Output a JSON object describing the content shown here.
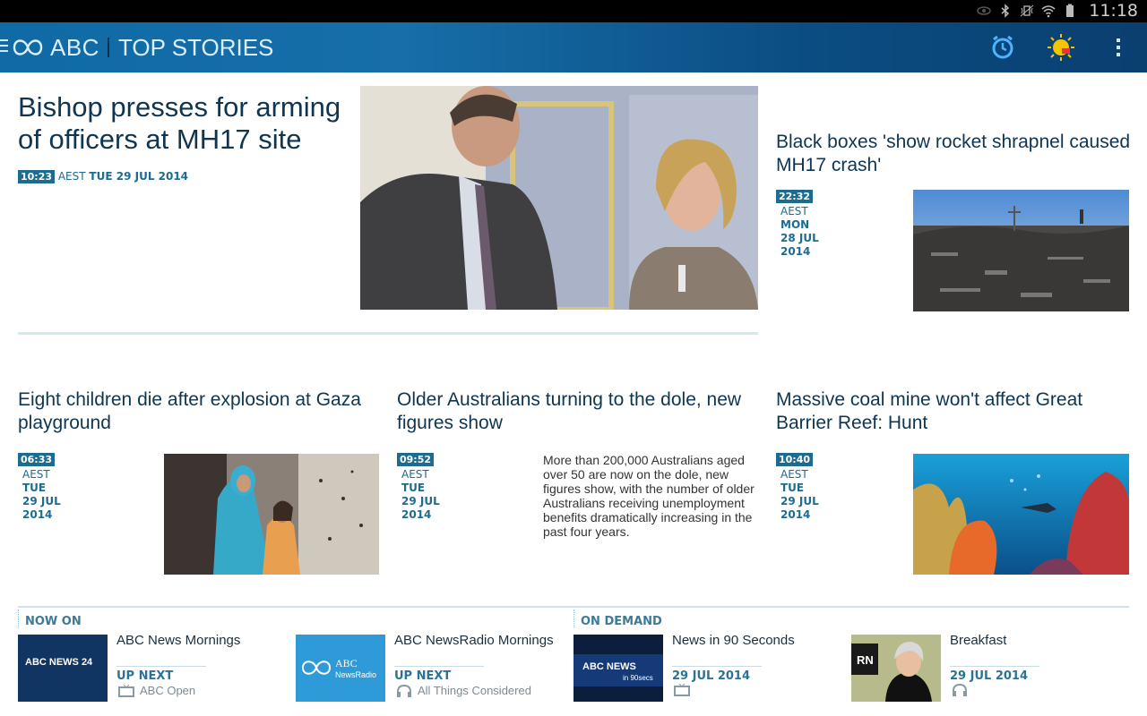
{
  "status_bar": {
    "time": "11:18",
    "icons": [
      "eye-icon",
      "bluetooth-icon",
      "vibrate-icon",
      "wifi-icon",
      "battery-icon"
    ]
  },
  "app_bar": {
    "brand": "ABC",
    "section": "TOP STORIES",
    "actions": [
      "alarm-clock-icon",
      "weather-icon",
      "overflow-menu-icon"
    ]
  },
  "stories": {
    "lead": {
      "title": "Bishop presses for arming of officers at MH17 site",
      "time": "10:23",
      "tz": "AEST",
      "date": "TUE 29 JUL 2014"
    },
    "side": {
      "title": "Black boxes 'show rocket shrapnel caused MH17 crash'",
      "time": "22:32",
      "tz": "AEST",
      "day": "MON",
      "daymonth": "28 JUL",
      "year": "2014"
    },
    "gaza": {
      "title": "Eight children die after explosion at Gaza playground",
      "time": "06:33",
      "tz": "AEST",
      "day": "TUE",
      "daymonth": "29 JUL",
      "year": "2014"
    },
    "dole": {
      "title": "Older Australians turning to the dole, new figures show",
      "time": "09:52",
      "tz": "AEST",
      "day": "TUE",
      "daymonth": "29 JUL",
      "year": "2014",
      "summary": "More than 200,000 Australians aged over 50 are now on the dole, new figures show, with the number of older Australians receiving unemployment benefits dramatically increasing in the past four years."
    },
    "reef": {
      "title": "Massive coal mine won't affect Great Barrier Reef: Hunt",
      "time": "10:40",
      "tz": "AEST",
      "day": "TUE",
      "daymonth": "29 JUL",
      "year": "2014"
    }
  },
  "now_on": {
    "label": "NOW ON",
    "items": [
      {
        "title": "ABC News Mornings",
        "sub": "UP NEXT",
        "next": "ABC Open",
        "thumb_text": "ABC NEWS 24"
      },
      {
        "title": "ABC NewsRadio Mornings",
        "sub": "UP NEXT",
        "next": "All Things Considered",
        "thumb_text_1": "ABC",
        "thumb_text_2": "NewsRadio"
      }
    ]
  },
  "on_demand": {
    "label": "ON DEMAND",
    "items": [
      {
        "title": "News in 90 Seconds",
        "sub": "29 JUL 2014",
        "thumb_text_1": "ABC NEWS",
        "thumb_text_2": "in 90secs"
      },
      {
        "title": "Breakfast",
        "sub": "29 JUL 2014",
        "thumb_text": "RN"
      }
    ]
  },
  "colors": {
    "accent": "#1d6b8e",
    "headline": "#0f3550",
    "appbar": "#0f6aa6"
  }
}
